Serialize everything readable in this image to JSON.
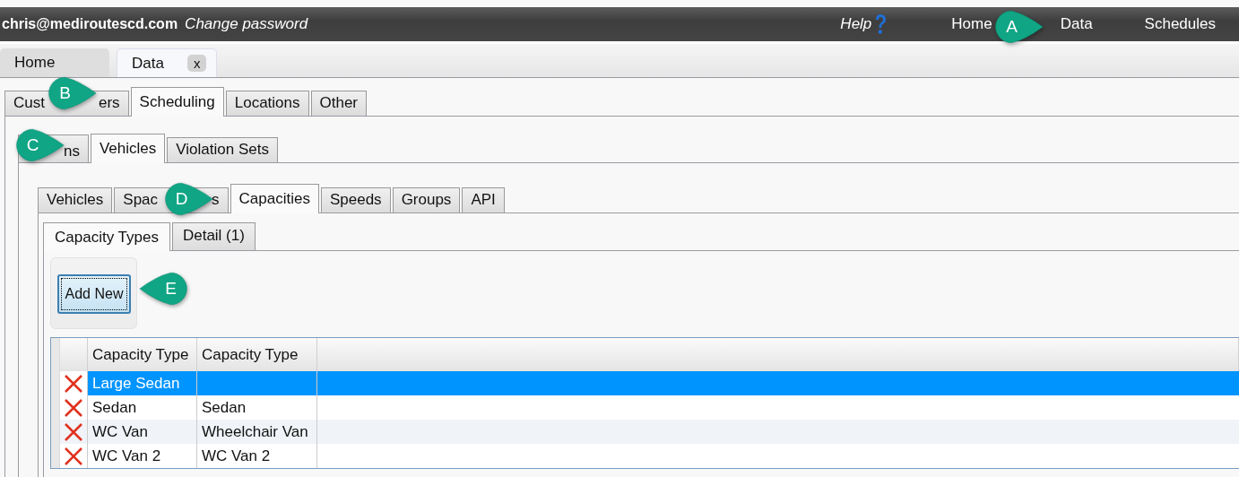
{
  "top_bar": {
    "user": "chris@mediroutescd.com",
    "change_password": "Change password",
    "help": "Help",
    "nav": [
      {
        "label": "Home",
        "selected": false
      },
      {
        "label": "Data",
        "selected": false
      },
      {
        "label": "Schedules",
        "selected": false
      }
    ]
  },
  "document_tabs": [
    {
      "label": "Home",
      "selected": false
    },
    {
      "label": "Data",
      "selected": true,
      "close": "x"
    }
  ],
  "tabs_level_1": [
    {
      "parts": [
        "Cust",
        "ers"
      ],
      "selected": false
    },
    {
      "parts": [
        "Scheduling"
      ],
      "selected": true
    },
    {
      "parts": [
        "Locations"
      ],
      "selected": false
    },
    {
      "parts": [
        "Other"
      ],
      "selected": false
    }
  ],
  "tabs_level_2": [
    {
      "parts": [
        "ns"
      ],
      "selected": false
    },
    {
      "parts": [
        "Vehicles"
      ],
      "selected": true
    },
    {
      "parts": [
        "Violation Sets"
      ],
      "selected": false
    }
  ],
  "tabs_level_3": [
    {
      "parts": [
        "Vehicles"
      ],
      "selected": false
    },
    {
      "parts": [
        "Spac",
        "s"
      ],
      "selected": false
    },
    {
      "parts": [
        "Capacities"
      ],
      "selected": true
    },
    {
      "parts": [
        "Speeds"
      ],
      "selected": false
    },
    {
      "parts": [
        "Groups"
      ],
      "selected": false
    },
    {
      "parts": [
        "API"
      ],
      "selected": false
    }
  ],
  "tabs_level_4": [
    {
      "label": "Capacity Types",
      "selected": true
    },
    {
      "label": "Detail (1)",
      "selected": false
    }
  ],
  "add_button": "Add New",
  "table": {
    "columns": [
      "Capacity Type",
      "Capacity Type"
    ],
    "rows": [
      {
        "cells": [
          "Large Sedan",
          ""
        ],
        "selected": true
      },
      {
        "cells": [
          "Sedan",
          "Sedan"
        ],
        "selected": false
      },
      {
        "cells": [
          "WC Van",
          "Wheelchair Van"
        ],
        "selected": false
      },
      {
        "cells": [
          "WC Van 2",
          "WC Van 2"
        ],
        "selected": false
      }
    ]
  },
  "callouts": [
    {
      "letter": "A",
      "kind": "rightward"
    },
    {
      "letter": "B",
      "kind": "rightward"
    },
    {
      "letter": "C",
      "kind": "rightward"
    },
    {
      "letter": "D",
      "kind": "rightward"
    },
    {
      "letter": "E",
      "kind": "leftward"
    }
  ]
}
